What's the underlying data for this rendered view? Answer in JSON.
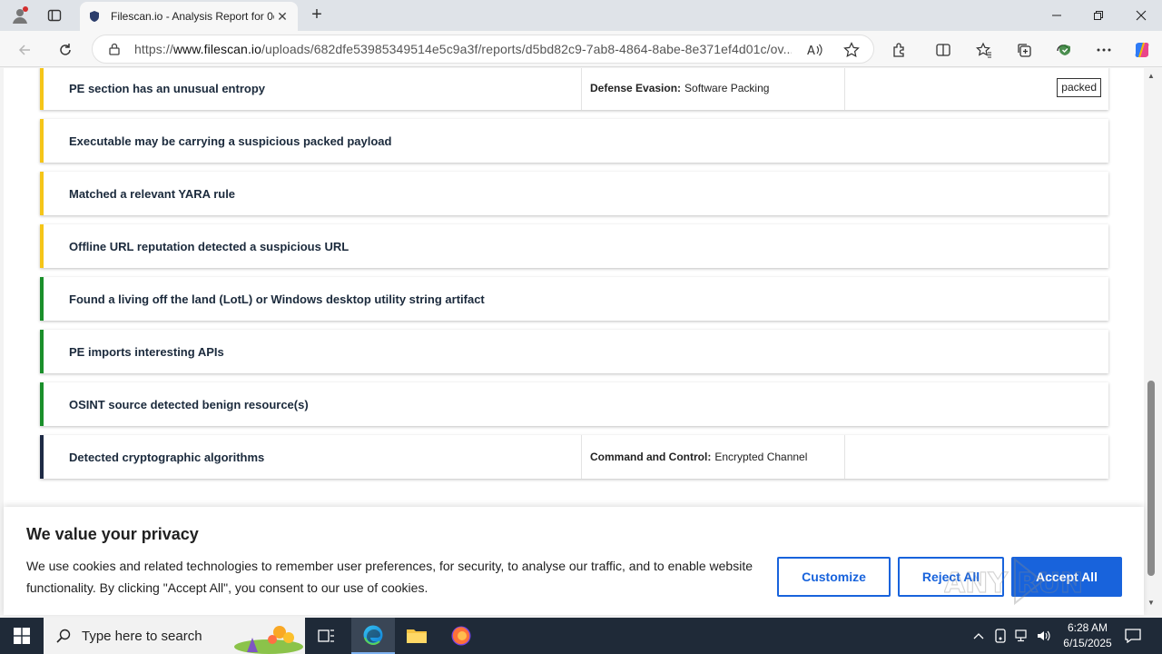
{
  "browser": {
    "tab_title": "Filescan.io - Analysis Report for 0c",
    "url_prefix": "https://",
    "url_domain": "www.filescan.io",
    "url_path": "/uploads/682dfe53985349514e5c9a3f/reports/d5bd82c9-7ab8-4864-8abe-8e371ef4d01c/ov..."
  },
  "findings": [
    {
      "title": "PE section has an unusual entropy",
      "tactic": "Defense Evasion:",
      "technique": "Software Packing",
      "tag": "packed",
      "level": "yellow"
    },
    {
      "title": "Executable may be carrying a suspicious packed payload",
      "level": "yellow"
    },
    {
      "title": "Matched a relevant YARA rule",
      "level": "yellow"
    },
    {
      "title": "Offline URL reputation detected a suspicious URL",
      "level": "yellow"
    },
    {
      "title": "Found a living off the land (LotL) or Windows desktop utility string artifact",
      "level": "green"
    },
    {
      "title": "PE imports interesting APIs",
      "level": "green"
    },
    {
      "title": "OSINT source detected benign resource(s)",
      "level": "green"
    },
    {
      "title": "Detected cryptographic algorithms",
      "tactic": "Command and Control:",
      "technique": "Encrypted Channel",
      "level": "dark"
    }
  ],
  "cookie": {
    "title": "We value your privacy",
    "text": "We use cookies and related technologies to remember user preferences, for security, to analyse our traffic, and to enable website functionality. By clicking \"Accept All\", you consent to our use of cookies.",
    "customize": "Customize",
    "reject": "Reject All",
    "accept": "Accept All"
  },
  "watermark": "ANY RUN",
  "taskbar": {
    "search_placeholder": "Type here to search",
    "time": "6:28 AM",
    "date": "6/15/2025"
  },
  "colors": {
    "yellow": "#f5c518",
    "green": "#1a8f2a",
    "dark": "#1e2a45",
    "accent_blue": "#1863dc"
  }
}
